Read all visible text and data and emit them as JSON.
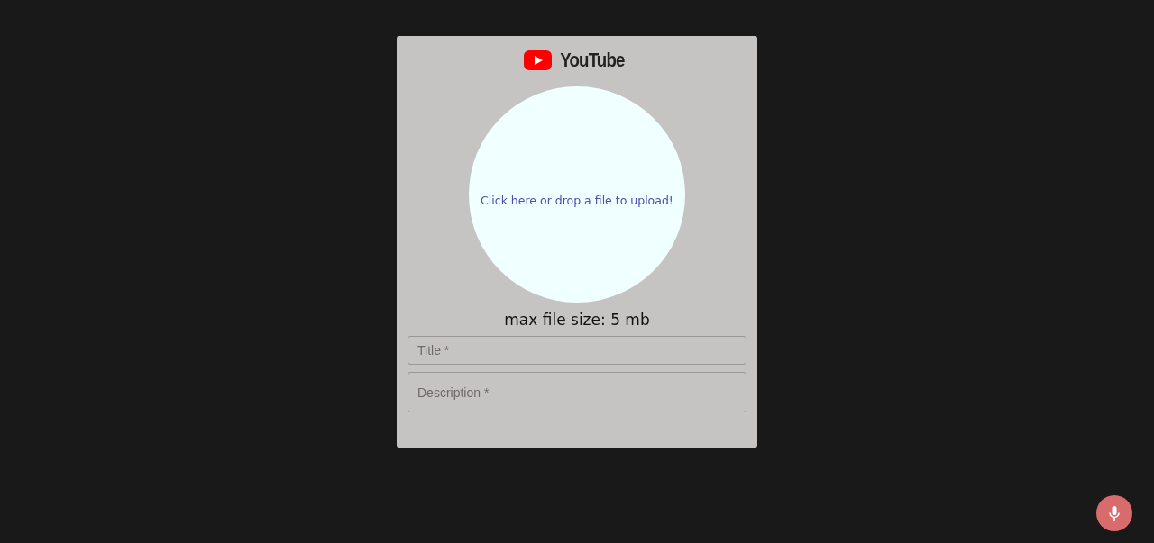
{
  "logo": {
    "text": "YouTube"
  },
  "upload": {
    "prompt": "Click here or drop a file to upload!"
  },
  "max_size": "max file size: 5 mb",
  "fields": [
    {
      "placeholder": "Title *",
      "kind": "single"
    },
    {
      "placeholder": "Description *",
      "kind": "multi"
    }
  ],
  "mic_button": {
    "kind": "mic"
  }
}
